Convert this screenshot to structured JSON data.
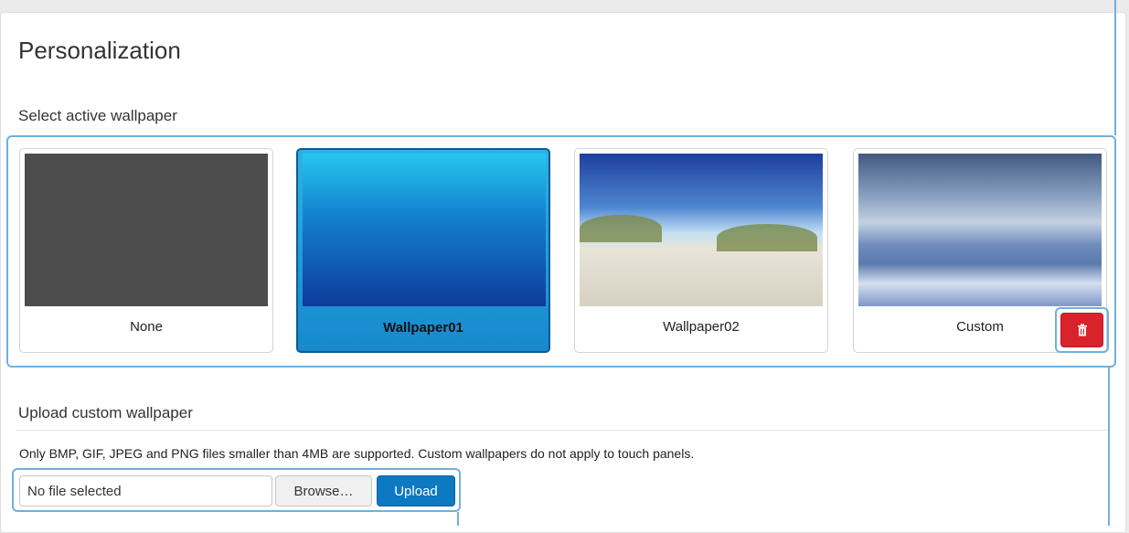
{
  "page": {
    "title": "Personalization"
  },
  "wallpaper_section": {
    "title": "Select active wallpaper",
    "options": [
      {
        "label": "None",
        "selected": false
      },
      {
        "label": "Wallpaper01",
        "selected": true
      },
      {
        "label": "Wallpaper02",
        "selected": false
      },
      {
        "label": "Custom",
        "selected": false
      }
    ],
    "delete_icon": "trash-icon",
    "delete_color": "#d9232c"
  },
  "upload_section": {
    "title": "Upload custom wallpaper",
    "help_text": "Only BMP, GIF, JPEG and PNG files smaller than 4MB are supported. Custom wallpapers do not apply to touch panels.",
    "file_value": "No file selected",
    "browse_label": "Browse…",
    "upload_label": "Upload",
    "upload_color": "#0c79c2"
  },
  "accent_color": "#6fb1db"
}
